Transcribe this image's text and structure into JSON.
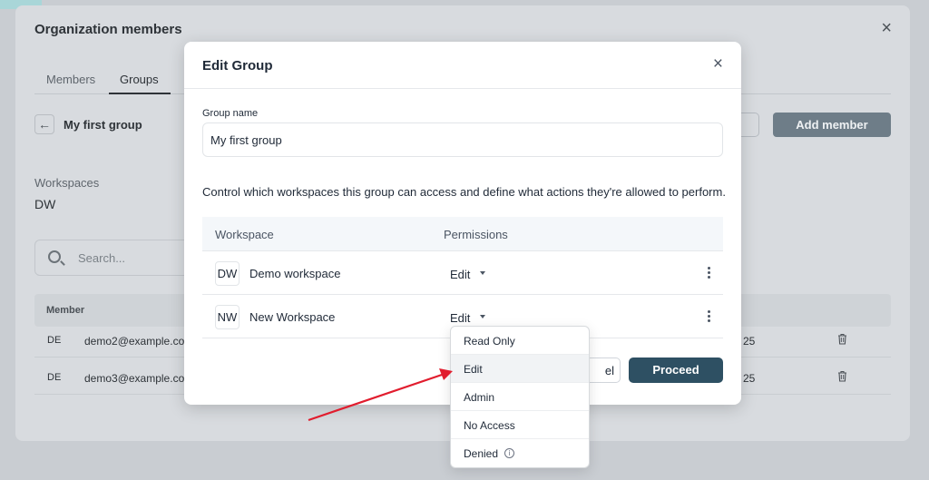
{
  "org_modal": {
    "title": "Organization members",
    "close": "×",
    "tabs": [
      {
        "label": "Members"
      },
      {
        "label": "Groups"
      }
    ],
    "back": "←",
    "group_name": "My first group",
    "add_member_label": "Add member",
    "workspaces_label": "Workspaces",
    "workspace_badge": "DW",
    "search_placeholder": "Search...",
    "table_header": "Member",
    "members": [
      {
        "avatar": "DE",
        "email": "demo2@example.co",
        "date": "25"
      },
      {
        "avatar": "DE",
        "email": "demo3@example.co",
        "date": "25"
      }
    ]
  },
  "edit_group": {
    "title": "Edit Group",
    "close": "×",
    "group_name_label": "Group name",
    "group_name_value": "My first group",
    "description": "Control which workspaces this group can access and define what actions they're allowed to perform.",
    "columns": {
      "workspace": "Workspace",
      "permissions": "Permissions"
    },
    "rows": [
      {
        "badge": "DW",
        "name": "Demo workspace",
        "permission": "Edit"
      },
      {
        "badge": "NW",
        "name": "New Workspace",
        "permission": "Edit"
      }
    ],
    "cancel_label": "el",
    "proceed_label": "Proceed"
  },
  "permission_dropdown": {
    "options": [
      {
        "label": "Read Only"
      },
      {
        "label": "Edit",
        "highlighted": true
      },
      {
        "label": "Admin"
      },
      {
        "label": "No Access"
      },
      {
        "label": "Denied",
        "icon": "info-icon",
        "icon_glyph": "i"
      }
    ]
  },
  "annotation": {
    "color": "#e11d2e",
    "icon": "red-arrow"
  }
}
